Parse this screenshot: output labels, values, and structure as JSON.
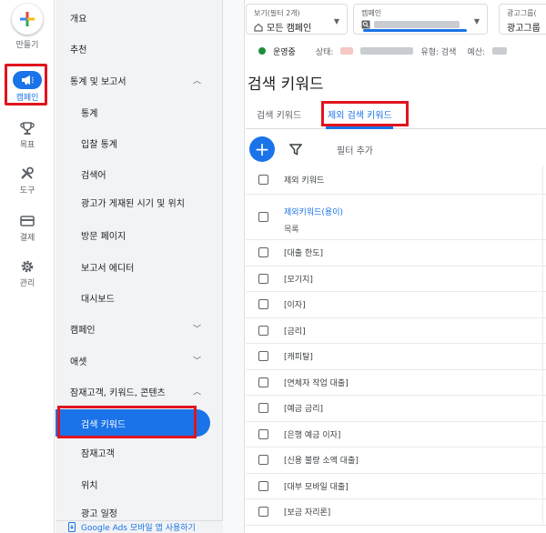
{
  "rail": {
    "create_label": "만들기",
    "campaign_label": "캠페인",
    "goals_label": "목표",
    "tools_label": "도구",
    "billing_label": "결제",
    "admin_label": "관리"
  },
  "nav": {
    "overview": "개요",
    "recommendations": "추천",
    "stats_reports": "통계 및 보고서",
    "stats": "통계",
    "auction_insights": "입찰 통계",
    "search_terms": "검색어",
    "when_where": "광고가 게재된 시기 및 위치",
    "landing_pages": "방문 페이지",
    "report_editor": "보고서 에디터",
    "dashboards": "대시보드",
    "campaigns": "캠페인",
    "assets": "애셋",
    "audiences_kw_content": "잠재고객, 키워드, 콘텐츠",
    "search_keywords": "검색 키워드",
    "audiences": "잠재고객",
    "locations": "위치",
    "ad_schedule": "광고 일정",
    "mobile_app": "Google Ads 모바일 앱 사용하기"
  },
  "filters": {
    "view_label": "보기(필터 2개)",
    "view_value": "모든 캠페인",
    "campaign_label": "캠페인",
    "adgroup_label": "광고그룹(",
    "adgroup_value": "광고그룹"
  },
  "status": {
    "running": "운영중",
    "status_label": "상태:",
    "type_label": "유형: 검색",
    "budget_label": "예산:"
  },
  "page": {
    "title": "검색 키워드"
  },
  "tabs": {
    "search_keywords": "검색 키워드",
    "negative_keywords": "제외 검색 키워드"
  },
  "toolbar": {
    "add_filter": "필터 추가"
  },
  "table": {
    "header": "제외 키워드",
    "list_link": "제외키워드(용이)",
    "list_sub": "목록",
    "rows": [
      "[대출 한도]",
      "[모기지]",
      "[이자]",
      "[금리]",
      "[캐피탈]",
      "[연체자 작업 대출]",
      "[예금 금리]",
      "[은행 예금 이자]",
      "[신용 불량 소액 대출]",
      "[대부 모바일 대출]",
      "[보금 자리론]"
    ]
  },
  "colors": {
    "accent": "#1a73e8",
    "highlight": "#e0141e",
    "running": "#1e8e3e"
  }
}
